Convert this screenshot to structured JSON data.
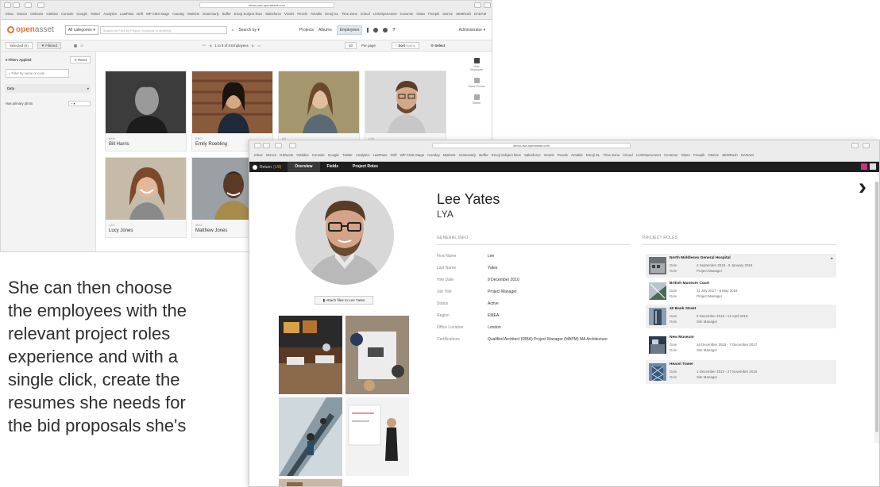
{
  "back_window": {
    "browser": {
      "address": "demo-awt.openasset.com",
      "bookmarks": [
        "Inbox",
        "GDocs",
        "GSheets",
        "GSlides",
        "Console",
        "Google",
        "Twitter",
        "Analytics",
        "LastPass",
        "Drift",
        "WP CMS Stage",
        "monday",
        "Markets",
        "Grammarly",
        "Buffer",
        "Emoji Subject lines",
        "Salesforce",
        "Vexels",
        "Pexels",
        "AVIable",
        "Emoji SL",
        "Time Zone",
        "iCloud",
        "LIVEOpenAsset",
        "Cezanne",
        "Glass",
        "Freepik",
        "GDrive",
        "SEMRush",
        "DADAM"
      ]
    },
    "app": {
      "logo_main": "open",
      "logo_accent": "asset",
      "category": "All categories",
      "search_placeholder": "Search for Files by Project, Keyword or anything",
      "search_by": "Search by ▾",
      "nav": [
        "Projects",
        "Albums",
        "Employees"
      ],
      "user": "Administrator ▾"
    },
    "toolbar": {
      "selected": "Selected (0)",
      "filtered": "Filtered",
      "paging": "1 to 8 of 8 Employees",
      "per_page_value": "50",
      "per_page_label": "Per page",
      "sort_label": "Sort",
      "sort_value": "Name",
      "select": "Select"
    },
    "sidebar": {
      "filters_applied": "0 Filters Applied",
      "reset": "Reset",
      "filter_placeholder": "Filter by name or code",
      "section": "Data",
      "has_primary_photo_label": "Has primary photo",
      "has_primary_photo_value": "–"
    },
    "employees": [
      {
        "code": "BHA",
        "name": "Bill Harris"
      },
      {
        "code": "ERO",
        "name": "Emily Roebling"
      },
      {
        "code": "LB",
        "name": ""
      },
      {
        "code": "LYA",
        "name": ""
      },
      {
        "code": "LJO",
        "name": "Lucy Jones"
      },
      {
        "code": "MJO",
        "name": "Matthew Jones"
      }
    ],
    "right_actions": [
      {
        "icon": "new-employee-icon",
        "label": "New Employee"
      },
      {
        "icon": "share-photos-icon",
        "label": "Share Photos"
      },
      {
        "icon": "delete-icon",
        "label": "Delete"
      }
    ]
  },
  "caption": {
    "lines": [
      "She can then choose",
      "the employees with the",
      "relevant project roles",
      "experience and with a",
      "single click, create the",
      "resumes she needs for",
      "the bid proposals she's"
    ]
  },
  "front_window": {
    "browser": {
      "address": "demo-awt.openasset.com",
      "bookmarks": [
        "Inbox",
        "GDocs",
        "GSheets",
        "GSlides",
        "Console",
        "Google",
        "Twitter",
        "Analytics",
        "LastPass",
        "Drift",
        "WP CMS Stage",
        "monday",
        "Markets",
        "Grammarly",
        "Buffer",
        "Emoji Subject lines",
        "Salesforce",
        "Vexels",
        "Pexels",
        "AVIable",
        "Emoji SL",
        "Time Zone",
        "iCloud",
        "LIVEOpenAsset",
        "Cezanne",
        "Glass",
        "Freepik",
        "GDrive",
        "SEMRush",
        "DADAM"
      ]
    },
    "tabs": {
      "return_label": "Return",
      "return_count": "(1/8)",
      "items": [
        "Overview",
        "Fields",
        "Project Roles"
      ]
    },
    "employee": {
      "name": "Lee Yates",
      "code": "LYA",
      "attach_label": "Attach files to Lee Yates"
    },
    "general_info": {
      "heading": "GENERAL INFO",
      "rows": [
        {
          "label": "First Name",
          "value": "Lee"
        },
        {
          "label": "Last Name",
          "value": "Yates"
        },
        {
          "label": "Hire Date",
          "value": "9 December 2010"
        },
        {
          "label": "Job Title",
          "value": "Project Manager"
        },
        {
          "label": "Status",
          "value": "Active"
        },
        {
          "label": "Region",
          "value": "EMEA"
        },
        {
          "label": "Office Location",
          "value": "London"
        },
        {
          "label": "Certifications",
          "value": "Qualified Architect (RIBA) Project Manager (MAPM) MA Architecture"
        }
      ]
    },
    "project_roles": {
      "heading": "PROJECT ROLES",
      "date_label": "Date",
      "role_label": "Role",
      "items": [
        {
          "project": "North Middlesex General Hospital",
          "date": "4 September 2018 - 9 January 2019",
          "role": "Project Manager"
        },
        {
          "project": "British Museum Court",
          "date": "11 July 2017 - 8 May 2018",
          "role": "Project Manager"
        },
        {
          "project": "40 Bank Street",
          "date": "5 December 2016 - 12 April 2018",
          "role": "Site Manager"
        },
        {
          "project": "New Museum",
          "date": "16 December 2015 - 7 December 2017",
          "role": "Site Manager"
        },
        {
          "project": "Hearst Tower",
          "date": "1 December 2015 - 27 November 2016",
          "role": "Site Manager"
        }
      ]
    }
  }
}
